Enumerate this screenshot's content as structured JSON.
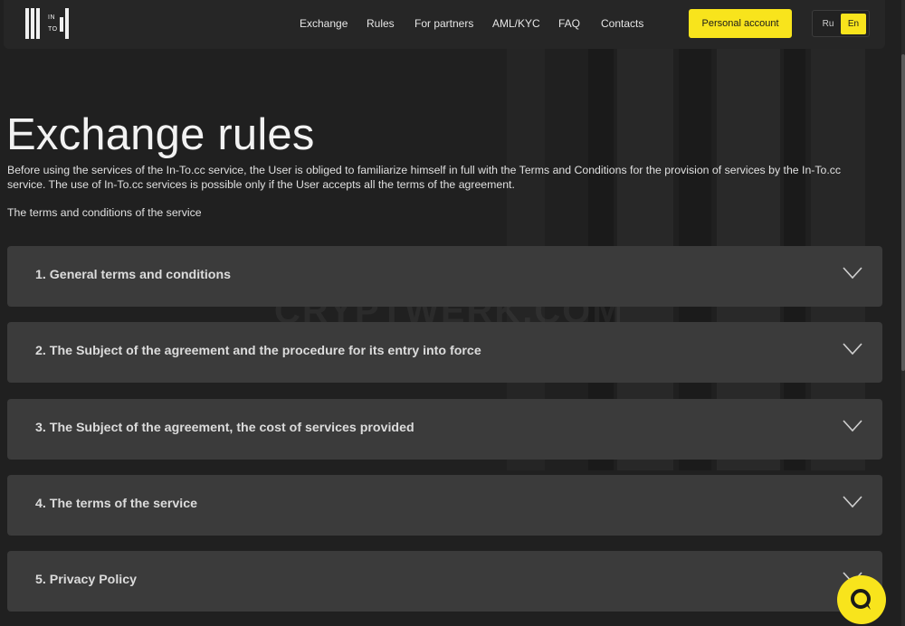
{
  "header": {
    "logo": {
      "line1": "IN",
      "line2": "TO"
    },
    "nav": [
      {
        "label": "Exchange"
      },
      {
        "label": "Rules"
      },
      {
        "label": "For partners"
      },
      {
        "label": "AML/KYC"
      },
      {
        "label": "FAQ"
      },
      {
        "label": "Contacts"
      }
    ],
    "account_label": "Personal account",
    "lang": {
      "ru": "Ru",
      "en": "En",
      "active": "en"
    }
  },
  "main": {
    "title": "Exchange rules",
    "intro": "Before using the services of the In-To.cc service, the User is obliged to familiarize himself in full with the Terms and Conditions for the provision of services by the In-To.cc service. The use of In-To.cc services is possible only if the User accepts all the terms of the agreement.",
    "terms_link": "The terms and conditions of the service",
    "sections": [
      {
        "title": "1. General terms and conditions"
      },
      {
        "title": "2. The Subject of the agreement and the procedure for its entry into force"
      },
      {
        "title": "3. The Subject of the agreement, the cost of services provided"
      },
      {
        "title": "4. The terms of the service"
      },
      {
        "title": "5. Privacy Policy"
      }
    ]
  },
  "watermark": "CRYPTWERK.COM",
  "colors": {
    "accent": "#f8e41c",
    "background": "#202020",
    "panel": "#3b3b3b"
  },
  "icons": {
    "section_toggle": "chevron-down-icon",
    "chat": "chat-bubble-icon"
  }
}
